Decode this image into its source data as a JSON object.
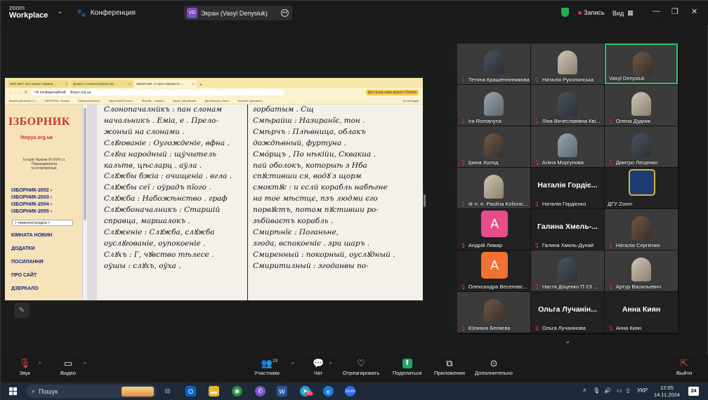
{
  "app": {
    "logo_line1": "zoom",
    "logo_line2": "Workplace",
    "meeting_title": "Конференция",
    "screen_share_initials": "VD",
    "screen_share_label": "Экран (Vasyl Denysiuk)",
    "record_label": "Запись",
    "view_label": "Вид"
  },
  "browser": {
    "tabs": [
      "UKR.NET: Всі новини України...",
      "Допрос к Аналитик@ukr.net...",
      "ІЗБОРНИК. Історія України IX-..."
    ],
    "address_security": "Не конфіденційний",
    "address_url": "litopys.org.ua",
    "offline_button": "Доступна нова версія Chrome",
    "bookmarks": [
      "Василь Денисюк | С...",
      "ІЗБОРНИК. Історія...",
      "Diaspora Електр...",
      "https://toxh20.ucoz...",
      "Slovniki – Instytut...",
      "Музеї | Музейний...",
      "Дім Франка | Лєха...",
      "Smoothi: Домовога...",
      "Усі закладки"
    ]
  },
  "izbornyk": {
    "brand": "ІЗБОРНИК",
    "site": "litopys.org.ua",
    "history_line1": "Історія України IX-XVIII ст.",
    "history_line2": "Першоджерела",
    "history_line3": "та інтерпретації.",
    "links": [
      "ІЗБОРНИК-2002 ›",
      "ІЗБОРНИК-2003 ›",
      "ІЗБОРНИК-2004 ›",
      "ІЗБОРНИК-2005 ›"
    ],
    "select_value": "> тематичні розділи <",
    "menu": [
      "КІМНАТА НОВИН",
      "ДОДАТКИ",
      "ПОСИЛАННЯ",
      "ПРО САЙТ",
      "ДЗЕРКАЛО"
    ]
  },
  "scan": {
    "left_col": [
      "Слонопачалнйкъ : пан слонам",
      "начальникъ . Еміа, е . Прело-",
      "жоный на слонами .",
      "Слꙋгованіе : Оугожденіе, вфна .",
      "Слꙋга народный : щўчытель",
      "кальтв, цѣсларц .   аўла .",
      "Слꙋжбы бжіа : очищеніа . вгла .",
      "Слꙋжбы сеї :   оўрадъ пїого .",
      "Слꙋжба : Набожѣнство .   граф",
      "Слꙋжбоначалникъ : Старшій",
      "справца, маршалокъ .",
      "Слꙋженіе : Слꙋжба, слꙋжба",
      "оуслꙋгованіе, оупокоеніе .",
      "Слꙋхъ : Г, чꙋвство тѣлесе .",
      "оўшы : слꙋхъ,   оўха ."
    ],
    "right_col": [
      "горбатым .        Сщ",
      "Смѣрайш :   Назиранїє, тон .",
      "Смѣрчъ :   Плѣвница, облакъ",
      "дождѣвный, фуртуна .",
      "Смόрщъ , По нѣкійи, Сквакиа .",
      "пай оболокъ, которыѣ з Нба",
      "спꙋстивши ся, водꙋ з щорм",
      "смоктꙋє : и єслй корабль набѣгне",
      "на тое мѣстцє, пзъ людми єго",
      "порвꙋєтъ, потом пꙋстивши ро-",
      "зьбйваєтъ корабль .",
      "Смирѣнїє :         Поганьне,",
      "згода, вспокоеніє .  зри шаръ .",
      "Смиренный : покорный, оуслꙋдный .",
      "Смиритилный : згоданвы по-"
    ]
  },
  "participants": [
    {
      "name": "Тетяна Крашеннінникова",
      "muted": true,
      "type": "video"
    },
    {
      "name": "Наталія Руколянська",
      "muted": true,
      "type": "video"
    },
    {
      "name": "Vasyl Denysiuk",
      "muted": false,
      "type": "video",
      "active": true
    },
    {
      "name": "Ira Romanyna",
      "muted": true,
      "type": "video"
    },
    {
      "name": "Ліна Вячеславівна Кві...",
      "muted": true,
      "type": "video"
    },
    {
      "name": "Олена Дудник",
      "muted": true,
      "type": "video"
    },
    {
      "name": "Ірина Холод",
      "muted": true,
      "type": "video"
    },
    {
      "name": "Аліна Моргунова",
      "muted": true,
      "type": "video"
    },
    {
      "name": "Дмитро Лещенко",
      "muted": true,
      "type": "video"
    },
    {
      "name": "dr n. e. Paulina Kolisnic...",
      "muted": true,
      "type": "video"
    },
    {
      "name": "Наталія Гордієнко",
      "muted": true,
      "type": "name",
      "big": "Наталія Гордіє..."
    },
    {
      "name": "ДГУ Zoom",
      "muted": false,
      "type": "logo"
    },
    {
      "name": "Андрій Лимар",
      "muted": true,
      "type": "avatar",
      "letter": "А",
      "color": "#e94c8b"
    },
    {
      "name": "Галина Хмель-Дунай",
      "muted": true,
      "type": "name",
      "big": "Галина Хмель-..."
    },
    {
      "name": "Наталія Сергієнко",
      "muted": true,
      "type": "photo"
    },
    {
      "name": "Олександра Веселовс...",
      "muted": true,
      "type": "avatar",
      "letter": "А",
      "color": "#f07131"
    },
    {
      "name": "Настя Доценко П-23 ...",
      "muted": true,
      "type": "photo"
    },
    {
      "name": "Артур Васильевич",
      "muted": true,
      "type": "photo"
    },
    {
      "name": "Юлиана Беляєва",
      "muted": true,
      "type": "photo"
    },
    {
      "name": "Ольга Лучанінова",
      "muted": true,
      "type": "name",
      "big": "Ольга Лучанін..."
    },
    {
      "name": "Анна Киян",
      "muted": true,
      "type": "name",
      "big": "Анна Киян"
    }
  ],
  "toolbar": {
    "audio": "Звук",
    "video": "Видео",
    "participants": "Участники",
    "participants_count": "29",
    "chat": "Чат",
    "react": "Отреагировать",
    "share": "Поделиться",
    "apps": "Приложения",
    "more": "Дополнительно",
    "leave": "Выйти"
  },
  "taskbar": {
    "search": "Пошук",
    "lang": "УКР",
    "time": "12:05",
    "date": "14.11.2024",
    "notif_count": "24",
    "telegram_badge": "82"
  }
}
